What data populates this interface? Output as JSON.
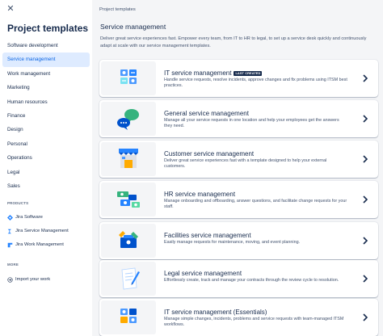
{
  "sidebar": {
    "title": "Project templates",
    "items": [
      {
        "label": "Software development",
        "active": false
      },
      {
        "label": "Service management",
        "active": true
      },
      {
        "label": "Work management",
        "active": false
      },
      {
        "label": "Marketing",
        "active": false
      },
      {
        "label": "Human resources",
        "active": false
      },
      {
        "label": "Finance",
        "active": false
      },
      {
        "label": "Design",
        "active": false
      },
      {
        "label": "Personal",
        "active": false
      },
      {
        "label": "Operations",
        "active": false
      },
      {
        "label": "Legal",
        "active": false
      },
      {
        "label": "Sales",
        "active": false
      }
    ],
    "products_heading": "PRODUCTS",
    "products": [
      {
        "label": "Jira Software",
        "icon": "jira-software-icon"
      },
      {
        "label": "Jira Service Management",
        "icon": "jira-service-management-icon"
      },
      {
        "label": "Jira Work Management",
        "icon": "jira-work-management-icon"
      }
    ],
    "more_heading": "MORE",
    "import_label": "Import your work"
  },
  "main": {
    "breadcrumb": "Project templates",
    "title": "Service management",
    "description": "Deliver great service experiences fast. Empower every team, from IT to HR to legal, to set up a service desk quickly and continuously adapt at scale with our service management templates.",
    "cards": [
      {
        "title": "IT service management",
        "badge": "LAST CREATED",
        "description": "Handle service requests, resolve incidents, approve changes and fix problems using ITSM best practices.",
        "illustration": "it-service-illustration"
      },
      {
        "title": "General service management",
        "badge": "",
        "description": "Manage all your service requests in one location and help your employees get the answers they need.",
        "illustration": "general-service-illustration"
      },
      {
        "title": "Customer service management",
        "badge": "",
        "description": "Deliver great service experiences fast with a template designed to help your external customers.",
        "illustration": "customer-service-illustration"
      },
      {
        "title": "HR service management",
        "badge": "",
        "description": "Manage onboarding and offboarding, answer questions, and facilitate change requests for your staff.",
        "illustration": "hr-service-illustration"
      },
      {
        "title": "Facilities service management",
        "badge": "",
        "description": "Easily manage requests for maintenance, moving, and event planning.",
        "illustration": "facilities-service-illustration"
      },
      {
        "title": "Legal service management",
        "badge": "",
        "description": "Effortlessly create, track and manage your contracts through the review cycle to resolution.",
        "illustration": "legal-service-illustration"
      },
      {
        "title": "IT service management (Essentials)",
        "badge": "",
        "description": "Manage simple changes, incidents, problems and service requests with team-managed ITSM workflows.",
        "illustration": "it-essentials-illustration"
      }
    ]
  },
  "colors": {
    "accent": "#0c66e4",
    "active_bg": "#deebff",
    "text": "#172b4d",
    "subtle_text": "#42526e",
    "main_bg": "#f4f5f7"
  }
}
